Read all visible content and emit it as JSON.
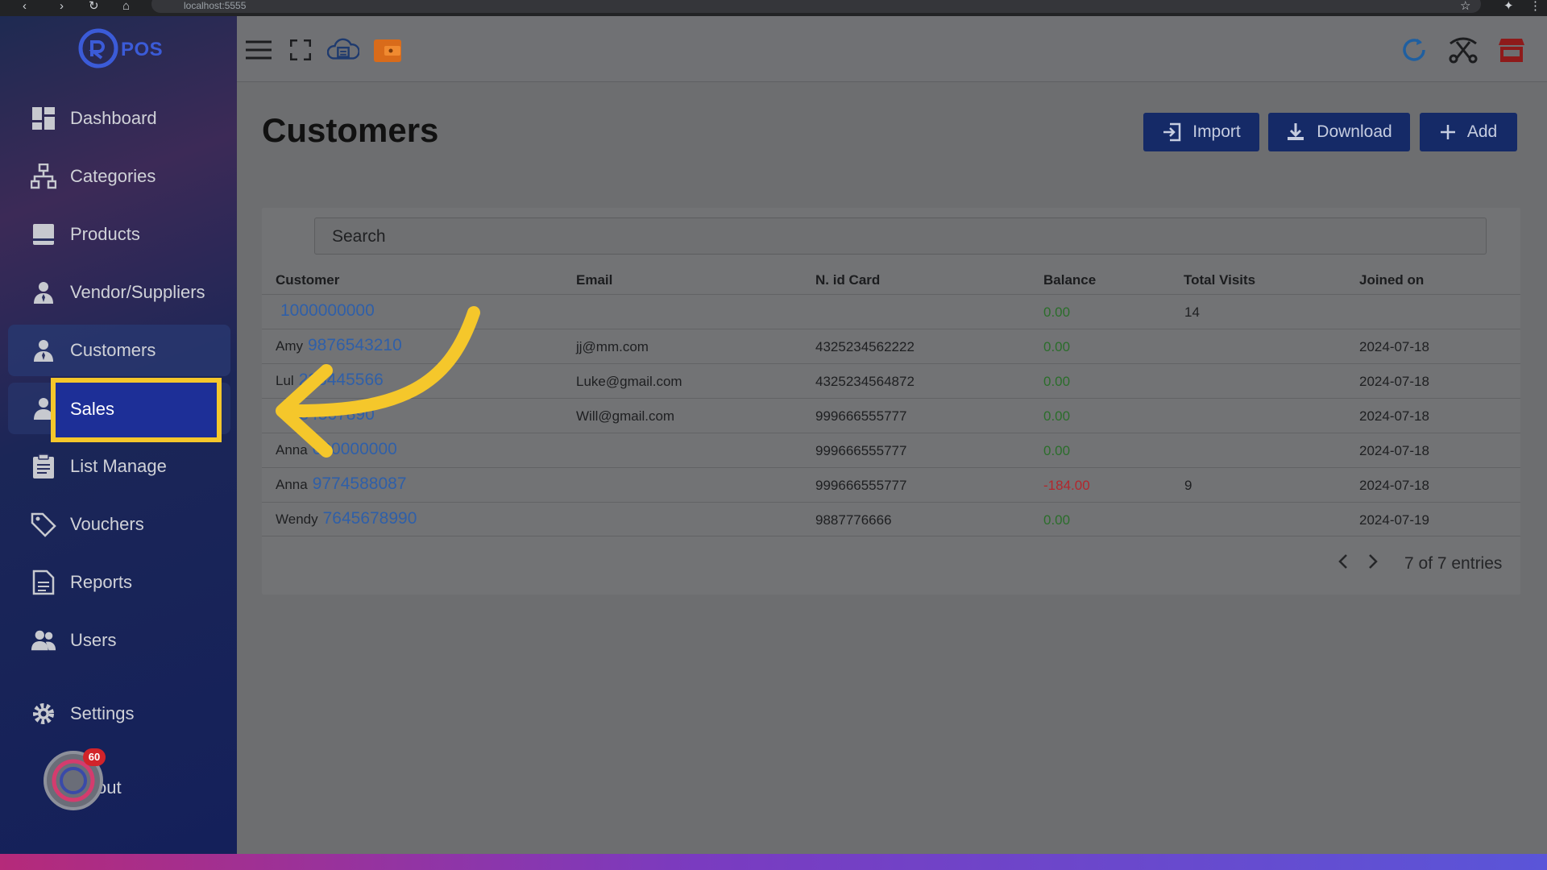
{
  "browser": {
    "url": "localhost:5555"
  },
  "logo": {
    "text": "POS"
  },
  "sidebar": {
    "items": [
      {
        "label": "Dashboard",
        "icon": "dashboard-icon"
      },
      {
        "label": "Categories",
        "icon": "hierarchy-icon"
      },
      {
        "label": "Products",
        "icon": "box-icon"
      },
      {
        "label": "Vendor/Suppliers",
        "icon": "user-tie-icon"
      },
      {
        "label": "Customers",
        "icon": "user-tie-icon"
      },
      {
        "label": "Sales",
        "icon": "user-tie-icon"
      },
      {
        "label": "List Manage",
        "icon": "clipboard-icon"
      },
      {
        "label": "Vouchers",
        "icon": "tag-icon"
      },
      {
        "label": "Reports",
        "icon": "file-icon"
      },
      {
        "label": "Users",
        "icon": "users-icon"
      },
      {
        "label": "Settings",
        "icon": "gear-icon"
      }
    ],
    "logout_partial": "out",
    "chat_badge": "60"
  },
  "header": {
    "title": "Customers",
    "import_label": "Import",
    "download_label": "Download",
    "add_label": "Add"
  },
  "search": {
    "placeholder": "Search"
  },
  "table": {
    "columns": [
      "Customer",
      "Email",
      "N. id Card",
      "Balance",
      "Total Visits",
      "Joined on"
    ],
    "rows": [
      {
        "name": "",
        "phone": "1000000000",
        "email": "",
        "id_card": "",
        "balance": "0.00",
        "visits": "14",
        "joined": ""
      },
      {
        "name": "Amy",
        "phone": "9876543210",
        "email": "jj@mm.com",
        "id_card": "4325234562222",
        "balance": "0.00",
        "visits": "",
        "joined": "2024-07-18"
      },
      {
        "name": "Lul",
        "phone": "233445566",
        "email": "Luke@gmail.com",
        "id_card": "4325234564872",
        "balance": "0.00",
        "visits": "",
        "joined": "2024-07-18"
      },
      {
        "name": "",
        "phone": "1234567890",
        "email": "Will@gmail.com",
        "id_card": "999666555777",
        "balance": "0.00",
        "visits": "",
        "joined": "2024-07-18"
      },
      {
        "name": "Anna",
        "phone": "000000000",
        "email": "",
        "id_card": "999666555777",
        "balance": "0.00",
        "visits": "",
        "joined": "2024-07-18"
      },
      {
        "name": "Anna",
        "phone": "9774588087",
        "email": "",
        "id_card": "999666555777",
        "balance": "-184.00",
        "visits": "9",
        "joined": "2024-07-18"
      },
      {
        "name": "Wendy",
        "phone": "7645678990",
        "email": "",
        "id_card": "9887776666",
        "balance": "0.00",
        "visits": "",
        "joined": "2024-07-19"
      }
    ]
  },
  "pagination": {
    "summary": "7 of 7 entries"
  },
  "colors": {
    "accent": "#152a67",
    "highlight": "#f5c72b",
    "link": "#2f5fa8",
    "positive": "#2b6e2b",
    "negative": "#b3272d"
  }
}
